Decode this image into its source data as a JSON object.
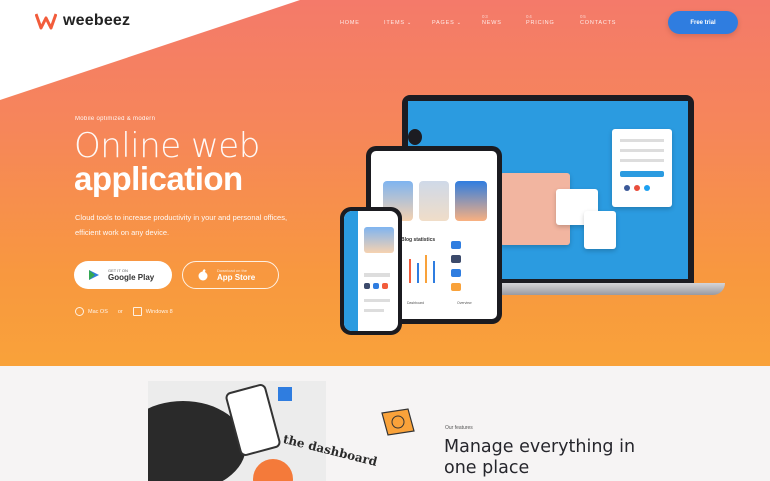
{
  "brand": {
    "name": "weebeez",
    "accent": "#f25c3b"
  },
  "nav": {
    "items": [
      {
        "num": "",
        "label": "HOME",
        "dropdown": false
      },
      {
        "num": "",
        "label": "ITEMS",
        "dropdown": true
      },
      {
        "num": "",
        "label": "PAGES",
        "dropdown": true
      },
      {
        "num": "03",
        "label": "NEWS",
        "dropdown": false
      },
      {
        "num": "04",
        "label": "PRICING",
        "dropdown": false
      },
      {
        "num": "05",
        "label": "CONTACTS",
        "dropdown": false
      }
    ],
    "cta_label": "Free trial",
    "cta_color": "#2f7de0"
  },
  "hero": {
    "eyebrow": "Mobile optimized & modern",
    "title_light": "Online web",
    "title_bold": "application",
    "description": "Cloud tools to increase productivity in your and personal offices, efficient work on any device.",
    "google_play": {
      "small": "GET IT ON",
      "big": "Google Play"
    },
    "app_store": {
      "small": "Download on the",
      "big": "App Store"
    },
    "platforms": [
      {
        "icon": "apple-icon",
        "label": "Mac OS"
      },
      {
        "icon": "windows-icon",
        "label": "Windows 8"
      }
    ],
    "gradient_top": "#f47a6a",
    "gradient_bottom": "#f9a23a"
  },
  "devices": {
    "tablet_heading": "Blog statistics",
    "tablet_footer_left": "Dashboard",
    "tablet_footer_right": "Overview"
  },
  "features": {
    "illustration_caption": "the dashboard",
    "eyebrow": "Our features",
    "heading": "Manage everything in one place"
  }
}
